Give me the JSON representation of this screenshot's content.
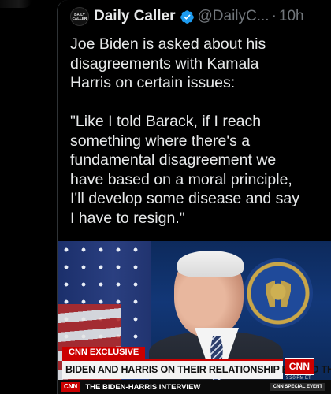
{
  "tweet": {
    "author": {
      "display_name": "Daily Caller",
      "handle": "@DailyC...",
      "avatar_text": [
        "DAILY",
        "CALLER"
      ]
    },
    "time": "10h",
    "separator": "·",
    "text_lines": [
      "Joe Biden is asked about his",
      "disagreements with Kamala",
      "Harris on certain issues:",
      "",
      "\"Like I told Barack, if I reach",
      "something where there's a",
      "fundamental disagreement we",
      "have based on a moral principle,",
      "I'll develop some disease and say",
      "I have to resign.\""
    ]
  },
  "video": {
    "chyron_tag": "CNN EXCLUSIVE",
    "chyron_headline": "BIDEN AND HARRIS ON THEIR RELATIONSHIP BEHIND THE SCENES",
    "logo": "CNN",
    "clock": "9:20 PM ET",
    "ticker_tag": "CNN",
    "ticker_text": "THE BIDEN-HARRIS INTERVIEW",
    "event_badge": "CNN SPECIAL EVENT"
  },
  "colors": {
    "background": "#000000",
    "verified_blue": "#1d9bf0",
    "cnn_red": "#cc0000",
    "muted_text": "#71767b"
  }
}
